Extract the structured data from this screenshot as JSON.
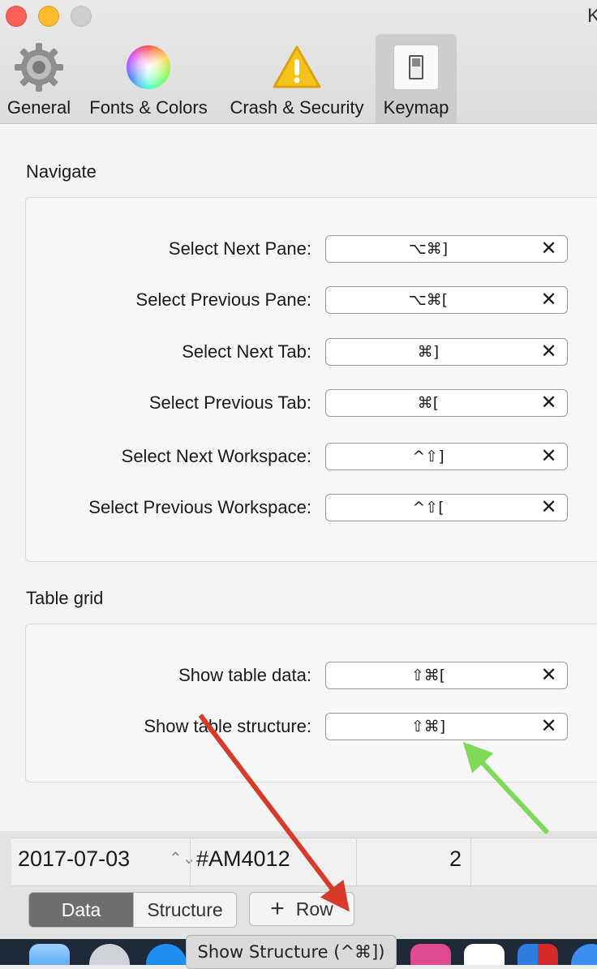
{
  "window": {
    "title_fragment": "K"
  },
  "toolbar": {
    "items": [
      {
        "label": "General",
        "icon": "gear-icon"
      },
      {
        "label": "Fonts & Colors",
        "icon": "color-wheel-icon"
      },
      {
        "label": "Crash & Security",
        "icon": "warning-icon"
      },
      {
        "label": "Keymap",
        "icon": "switch-icon",
        "active": true
      }
    ]
  },
  "navigate": {
    "title": "Navigate",
    "rows": [
      {
        "label": "Select Next Pane:",
        "shortcut": "⌥⌘]"
      },
      {
        "label": "Select Previous Pane:",
        "shortcut": "⌥⌘["
      },
      {
        "label": "Select Next Tab:",
        "shortcut": "⌘]"
      },
      {
        "label": "Select Previous Tab:",
        "shortcut": "⌘["
      },
      {
        "label": "Select Next Workspace:",
        "shortcut": "^⇧]"
      },
      {
        "label": "Select Previous Workspace:",
        "shortcut": "^⇧["
      }
    ]
  },
  "table_grid": {
    "title": "Table grid",
    "rows": [
      {
        "label": "Show table data:",
        "shortcut": "⇧⌘["
      },
      {
        "label": "Show table structure:",
        "shortcut": "⇧⌘]"
      }
    ]
  },
  "clear_symbol": "✕",
  "data_row": {
    "date": "2017-07-03",
    "stepper": "⌃⌄",
    "code": "#AM4012",
    "count": "2"
  },
  "footer": {
    "tab_data": "Data",
    "tab_structure": "Structure",
    "add_row_plus": "+",
    "add_row_label": "Row"
  },
  "tooltip": {
    "text": "Show Structure (^⌘])"
  },
  "colors": {
    "arrow_red": "#d83a2a",
    "arrow_green": "#7ed957",
    "active_segment": "#6e6e6e"
  }
}
